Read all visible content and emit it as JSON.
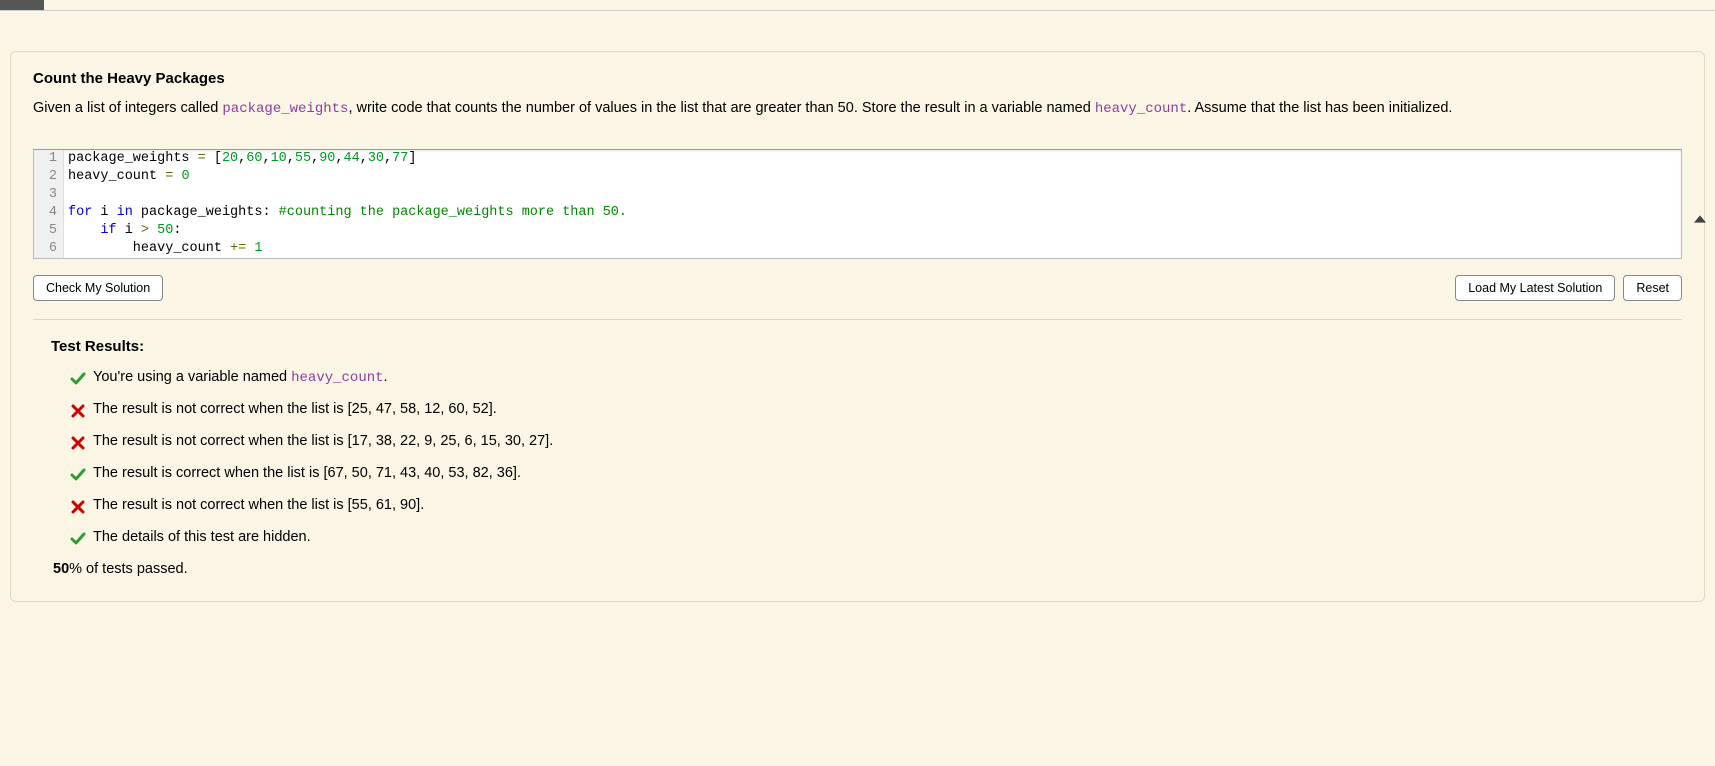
{
  "problem": {
    "title": "Count the Heavy Packages",
    "desc_before1": "Given a list of integers called ",
    "code1": "package_weights",
    "desc_mid1": ", write code that counts the number of values in the list that are greater than 50. Store the result in a variable named ",
    "code2": "heavy_count",
    "desc_after1": ". Assume that the list has been initialized."
  },
  "editor": {
    "lines": [
      {
        "n": "1",
        "tokens": [
          {
            "t": "package_weights ",
            "c": "tok-id"
          },
          {
            "t": "=",
            "c": "tok-op"
          },
          {
            "t": " [",
            "c": "tok-id"
          },
          {
            "t": "20",
            "c": "tok-num"
          },
          {
            "t": ",",
            "c": "tok-id"
          },
          {
            "t": "60",
            "c": "tok-num"
          },
          {
            "t": ",",
            "c": "tok-id"
          },
          {
            "t": "10",
            "c": "tok-num"
          },
          {
            "t": ",",
            "c": "tok-id"
          },
          {
            "t": "55",
            "c": "tok-num"
          },
          {
            "t": ",",
            "c": "tok-id"
          },
          {
            "t": "90",
            "c": "tok-num"
          },
          {
            "t": ",",
            "c": "tok-id"
          },
          {
            "t": "44",
            "c": "tok-num"
          },
          {
            "t": ",",
            "c": "tok-id"
          },
          {
            "t": "30",
            "c": "tok-num"
          },
          {
            "t": ",",
            "c": "tok-id"
          },
          {
            "t": "77",
            "c": "tok-num"
          },
          {
            "t": "]",
            "c": "tok-id"
          }
        ]
      },
      {
        "n": "2",
        "tokens": [
          {
            "t": "heavy_count ",
            "c": "tok-id"
          },
          {
            "t": "=",
            "c": "tok-op"
          },
          {
            "t": " ",
            "c": "tok-id"
          },
          {
            "t": "0",
            "c": "tok-num"
          }
        ]
      },
      {
        "n": "3",
        "tokens": []
      },
      {
        "n": "4",
        "tokens": [
          {
            "t": "for",
            "c": "tok-kw"
          },
          {
            "t": " i ",
            "c": "tok-id"
          },
          {
            "t": "in",
            "c": "tok-kw"
          },
          {
            "t": " package_weights: ",
            "c": "tok-id"
          },
          {
            "t": "#counting the package_weights more than 50.",
            "c": "tok-comment"
          }
        ]
      },
      {
        "n": "5",
        "tokens": [
          {
            "t": "    ",
            "c": "tok-id"
          },
          {
            "t": "if",
            "c": "tok-kw"
          },
          {
            "t": " i ",
            "c": "tok-id"
          },
          {
            "t": ">",
            "c": "tok-op"
          },
          {
            "t": " ",
            "c": "tok-id"
          },
          {
            "t": "50",
            "c": "tok-num"
          },
          {
            "t": ":",
            "c": "tok-id"
          }
        ]
      },
      {
        "n": "6",
        "tokens": [
          {
            "t": "        heavy_count ",
            "c": "tok-id"
          },
          {
            "t": "+=",
            "c": "tok-op"
          },
          {
            "t": " ",
            "c": "tok-id"
          },
          {
            "t": "1",
            "c": "tok-num"
          }
        ]
      }
    ]
  },
  "buttons": {
    "check": "Check My Solution",
    "load": "Load My Latest Solution",
    "reset": "Reset"
  },
  "results": {
    "heading": "Test Results:",
    "items": [
      {
        "pass": true,
        "pre": "You're using a variable named ",
        "code": "heavy_count",
        "post": "."
      },
      {
        "pass": false,
        "pre": "The result is not correct when the list is [25, 47, 58, 12, 60, 52].",
        "code": "",
        "post": ""
      },
      {
        "pass": false,
        "pre": "The result is not correct when the list is [17, 38, 22, 9, 25, 6, 15, 30, 27].",
        "code": "",
        "post": ""
      },
      {
        "pass": true,
        "pre": "The result is correct when the list is [67, 50, 71, 43, 40, 53, 82, 36].",
        "code": "",
        "post": ""
      },
      {
        "pass": false,
        "pre": "The result is not correct when the list is [55, 61, 90].",
        "code": "",
        "post": ""
      },
      {
        "pass": true,
        "pre": "The details of this test are hidden.",
        "code": "",
        "post": ""
      }
    ],
    "pct_bold": "50",
    "pct_rest": "% of tests passed."
  }
}
